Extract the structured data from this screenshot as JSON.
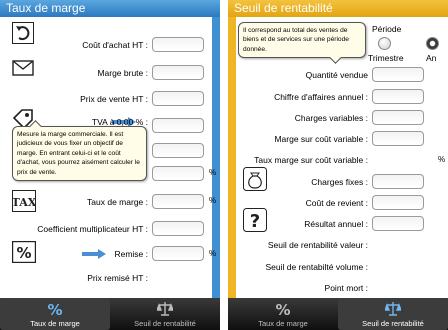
{
  "left": {
    "title": "Taux de marge",
    "fields": [
      {
        "label": "Coût d'achat HT :"
      },
      {
        "label": "Marge brute :"
      },
      {
        "label": "Prix de vente HT :"
      },
      {
        "label": "TVA à 0,00 % :"
      },
      {
        "label": "Taux de marge :",
        "unit": "%"
      },
      {
        "label": "Coefficient multiplicateur HT :"
      },
      {
        "label": "Remise :",
        "unit": "%"
      },
      {
        "label": "Prix remisé HT :"
      }
    ],
    "hidden_unit": "%",
    "tooltip": "Mesure la marge commerciale. Il est judicieux de vous fixer un objectif de marge. En entrant celui-ci et le coût d'achat, vous pourrez aisément calculer le prix de vente.",
    "icons": [
      "undo-arrow-icon",
      "envelope-icon",
      "price-tag-icon",
      "tax-icon",
      "percent-icon"
    ],
    "colors": {
      "title": "#2b79c0",
      "stripe": "#3f8fd3",
      "arrow": "#4a8fd6"
    }
  },
  "right": {
    "title": "Seuil de rentabilité",
    "tooltip": "Il correspond au total des ventes de biens et de services sur une période donnée.",
    "period": {
      "label": "Période",
      "options": [
        {
          "label": "Trimestre",
          "selected": false
        },
        {
          "label": "An",
          "selected": true
        }
      ]
    },
    "fields": [
      {
        "label": "Quantité vendue"
      },
      {
        "label": "Chiffre d'affaires annuel :"
      },
      {
        "label": "Charges variables :"
      },
      {
        "label": "Marge sur coût variable :"
      },
      {
        "label": "Taux marge sur coût variable :",
        "unit": "%"
      },
      {
        "label": "Charges fixes :"
      },
      {
        "label": "Coût de revient :"
      },
      {
        "label": "Résultat annuel :"
      }
    ],
    "results": [
      {
        "label": "Seuil de rentabilité valeur :"
      },
      {
        "label": "Seuil de rentabilté volume :"
      },
      {
        "label": "Point mort :"
      }
    ],
    "icons": [
      "money-bag-icon",
      "question-icon"
    ],
    "colors": {
      "title": "#e2a411",
      "stripe": "#efb524"
    }
  },
  "tabs": [
    {
      "label": "Taux de marge",
      "icon": "percent-tab-icon"
    },
    {
      "label": "Seuil de rentabilité",
      "icon": "scale-tab-icon"
    }
  ]
}
